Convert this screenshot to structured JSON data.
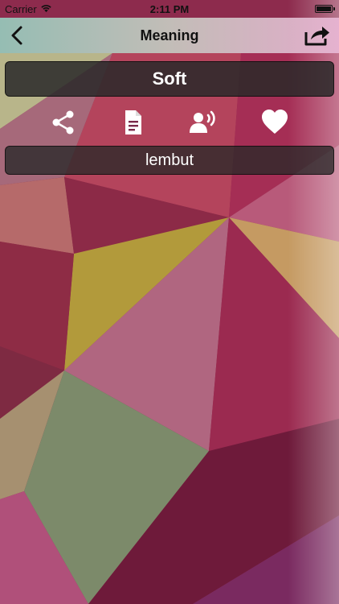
{
  "status_bar": {
    "carrier": "Carrier",
    "time": "2:11 PM"
  },
  "nav": {
    "title": "Meaning"
  },
  "word": "Soft",
  "meaning": "lembut",
  "actions": [
    "share-icon",
    "document-icon",
    "speak-icon",
    "favorite-icon"
  ],
  "colors": {
    "text_light": "#ffffff",
    "box_bg": "#282828"
  }
}
